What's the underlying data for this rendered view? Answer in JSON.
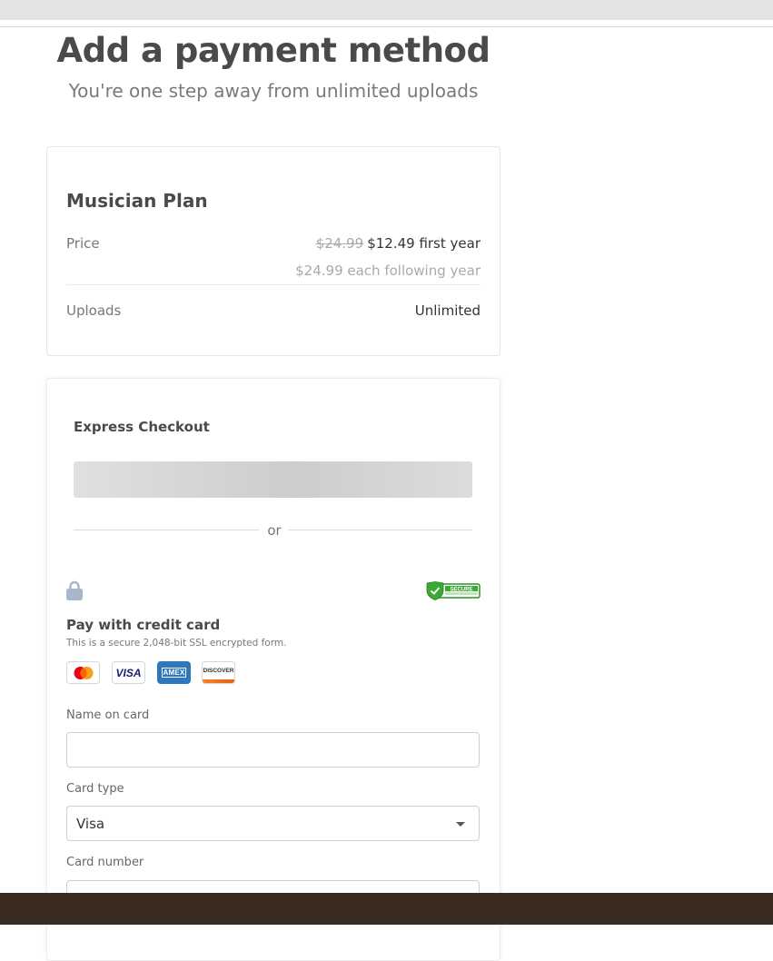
{
  "page": {
    "title": "Add a payment method",
    "subtitle": "You're one step away from unlimited uploads"
  },
  "plan": {
    "name": "Musician Plan",
    "price_label": "Price",
    "original_price": "$24.99",
    "discount_price": "$12.49 first year",
    "following_price": "$24.99 each following year",
    "uploads_label": "Uploads",
    "uploads_value": "Unlimited"
  },
  "express": {
    "title": "Express Checkout",
    "or_text": "or"
  },
  "credit_card": {
    "title": "Pay with credit card",
    "note": "This is a secure 2,048-bit SSL encrypted form.",
    "secure_badge_text": "SECURE",
    "logos": [
      "mastercard-icon",
      "visa-icon",
      "amex-icon",
      "discover-icon"
    ],
    "visa_text": "VISA",
    "amex_text": "AMEX",
    "discover_text": "DISCOVER"
  },
  "form": {
    "name_label": "Name on card",
    "name_value": "",
    "card_type_label": "Card type",
    "card_type_value": "Visa",
    "card_number_label": "Card number"
  },
  "colors": {
    "heading": "#4a4a4a",
    "muted": "#aaaaaa",
    "secure_green": "#3aa935",
    "footer": "#3a2b20"
  }
}
